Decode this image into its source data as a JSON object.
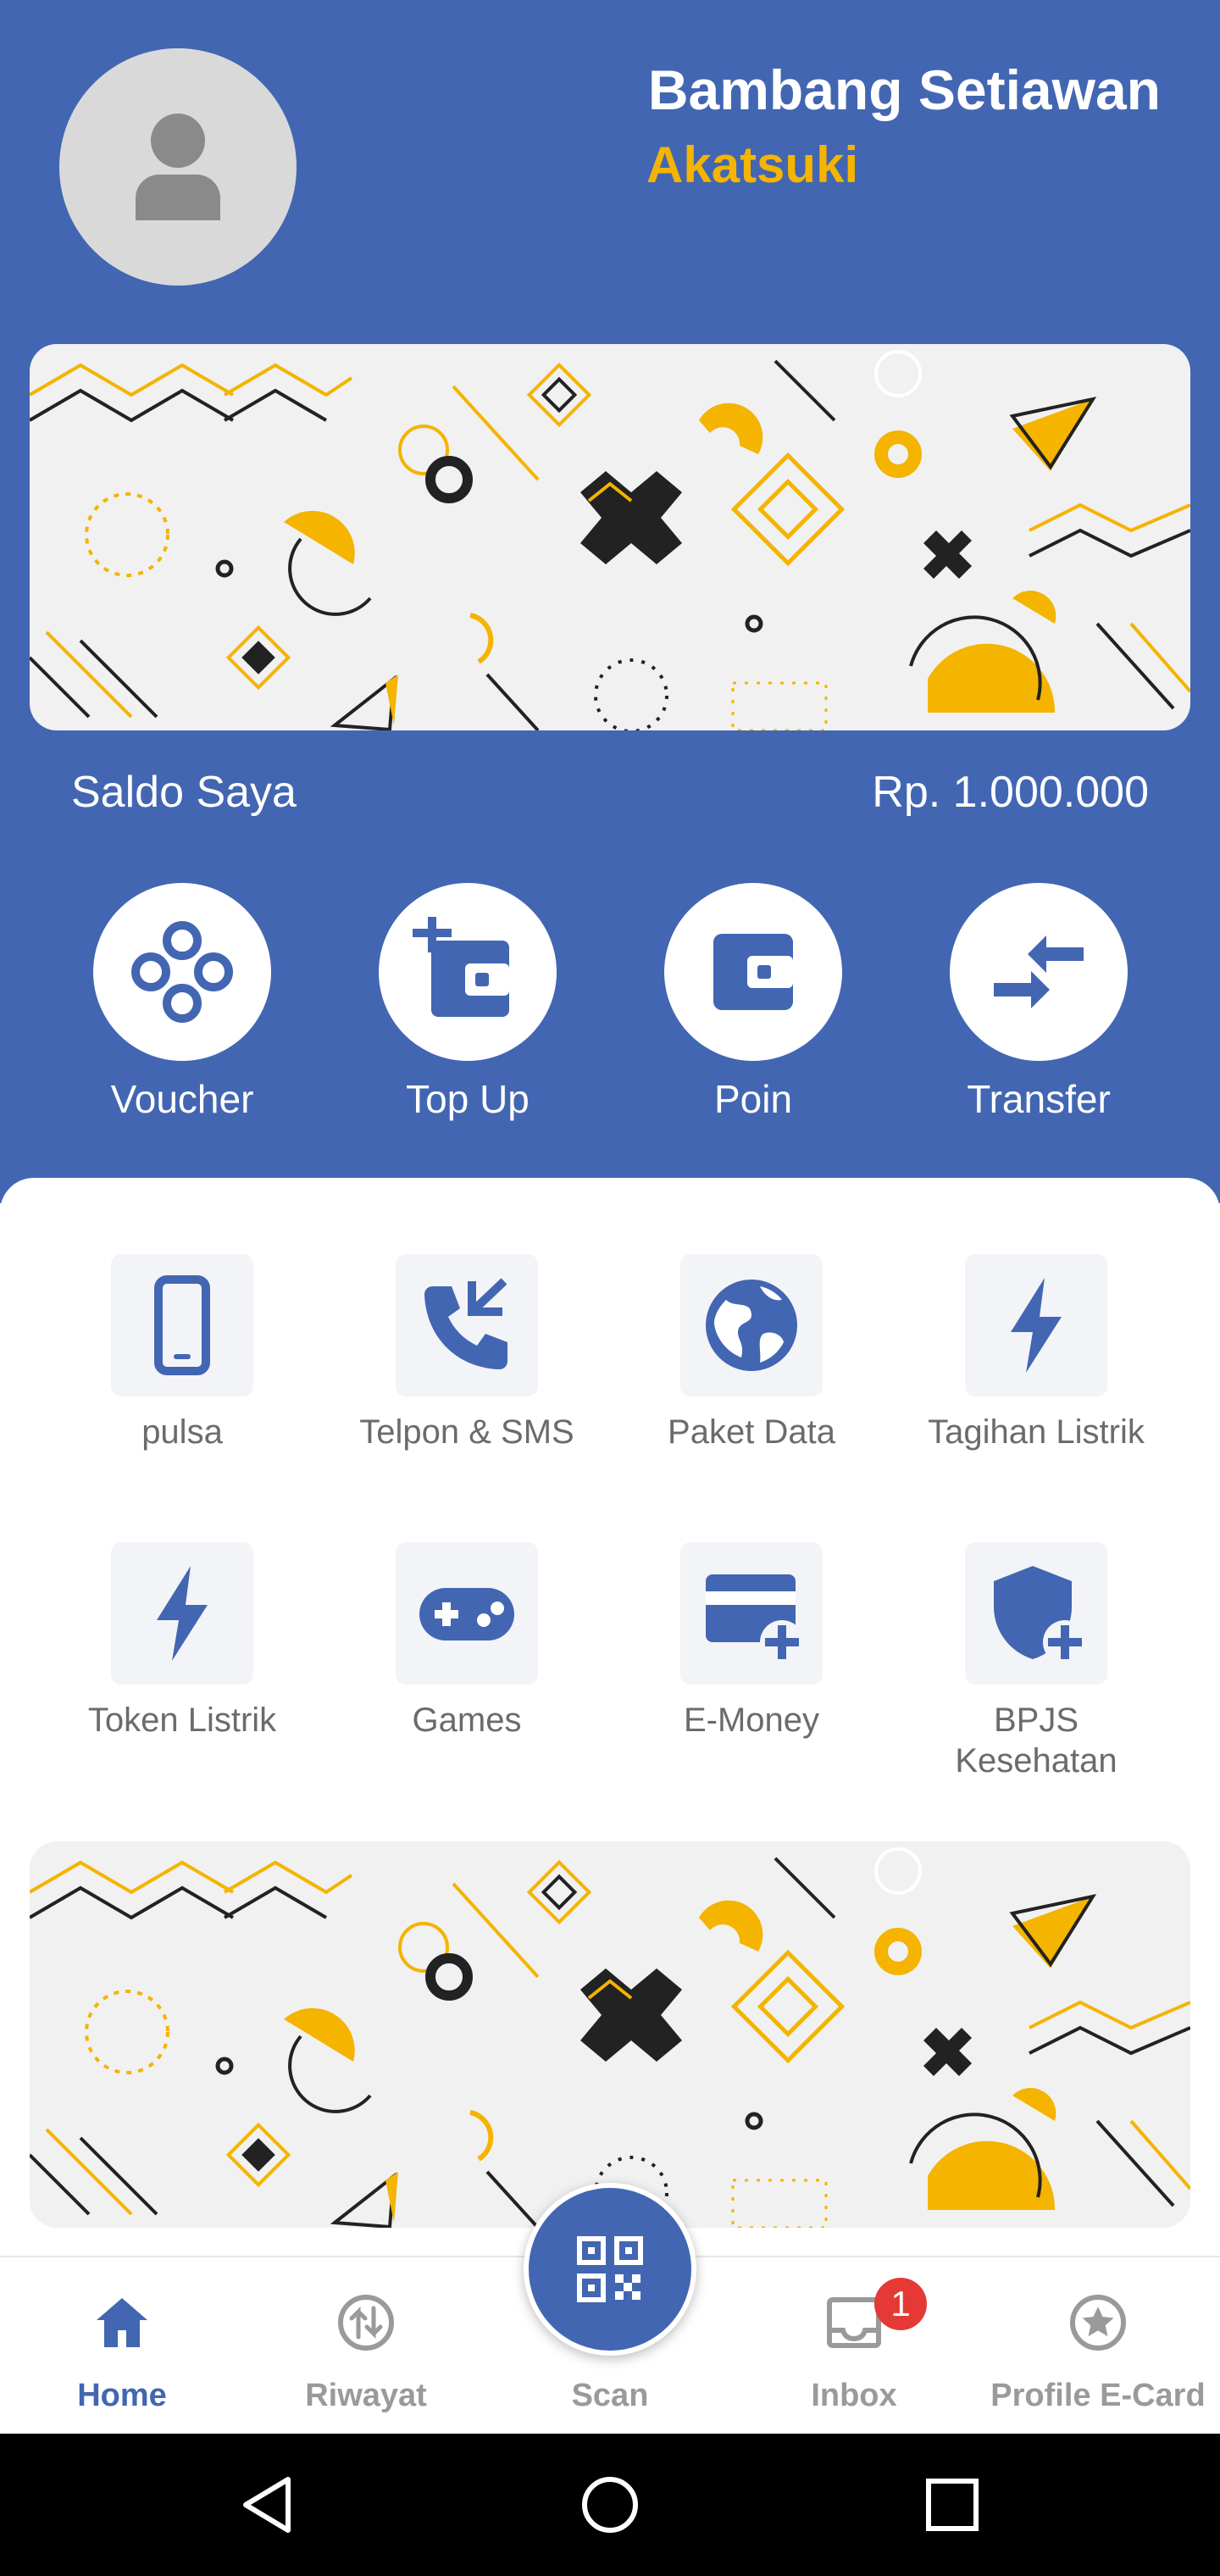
{
  "profile": {
    "name": "Bambang Setiawan",
    "group": "Akatsuki",
    "avatar_icon": "person-icon"
  },
  "balance": {
    "label": "Saldo Saya",
    "value": "Rp. 1.000.000"
  },
  "quick_actions": [
    {
      "label": "Voucher",
      "icon": "voucher-icon"
    },
    {
      "label": "Top Up",
      "icon": "top-up-icon"
    },
    {
      "label": "Poin",
      "icon": "wallet-icon"
    },
    {
      "label": "Transfer",
      "icon": "transfer-icon"
    }
  ],
  "services": [
    {
      "label": "pulsa",
      "icon": "phone-icon"
    },
    {
      "label": "Telpon & SMS",
      "icon": "call-icon"
    },
    {
      "label": "Paket Data",
      "icon": "globe-icon"
    },
    {
      "label": "Tagihan Listrik",
      "icon": "lightning-icon"
    },
    {
      "label": "Token Listrik",
      "icon": "lightning-icon"
    },
    {
      "label": "Games",
      "icon": "gamepad-icon"
    },
    {
      "label": "E-Money",
      "icon": "card-plus-icon"
    },
    {
      "label": "BPJS Kesehatan",
      "icon": "shield-plus-icon"
    }
  ],
  "tabs": [
    {
      "label": "Home",
      "icon": "home-icon",
      "active": true
    },
    {
      "label": "Riwayat",
      "icon": "history-icon"
    },
    {
      "label": "Scan",
      "icon": "qr-code-icon"
    },
    {
      "label": "Inbox",
      "icon": "inbox-icon",
      "badge": "1"
    },
    {
      "label": "Profile E-Card",
      "icon": "star-icon"
    }
  ],
  "colors": {
    "primary": "#4266b2",
    "accent": "#f4b400",
    "badge": "#e53935"
  }
}
